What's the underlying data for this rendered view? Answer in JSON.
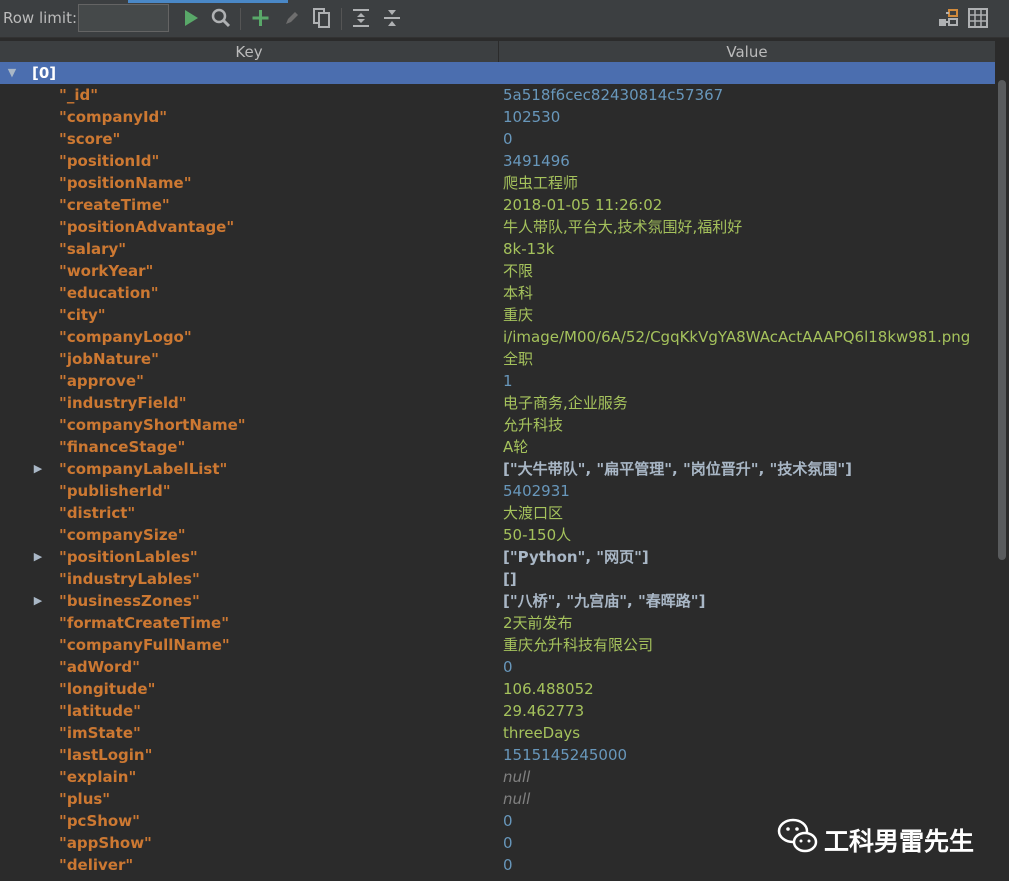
{
  "toolbar": {
    "row_limit_label": "Row limit:",
    "row_limit_value": ""
  },
  "header": {
    "key": "Key",
    "value": "Value"
  },
  "root": {
    "label": "[0]"
  },
  "rows": [
    {
      "key": "\"_id\"",
      "value": "5a518f6cec82430814c57367",
      "type": "num",
      "expandable": false
    },
    {
      "key": "\"companyId\"",
      "value": "102530",
      "type": "num",
      "expandable": false
    },
    {
      "key": "\"score\"",
      "value": "0",
      "type": "num",
      "expandable": false
    },
    {
      "key": "\"positionId\"",
      "value": "3491496",
      "type": "num",
      "expandable": false
    },
    {
      "key": "\"positionName\"",
      "value": "爬虫工程师",
      "type": "str",
      "expandable": false
    },
    {
      "key": "\"createTime\"",
      "value": "2018-01-05 11:26:02",
      "type": "str",
      "expandable": false
    },
    {
      "key": "\"positionAdvantage\"",
      "value": "牛人带队,平台大,技术氛围好,福利好",
      "type": "str",
      "expandable": false
    },
    {
      "key": "\"salary\"",
      "value": "8k-13k",
      "type": "str",
      "expandable": false
    },
    {
      "key": "\"workYear\"",
      "value": "不限",
      "type": "str",
      "expandable": false
    },
    {
      "key": "\"education\"",
      "value": "本科",
      "type": "str",
      "expandable": false
    },
    {
      "key": "\"city\"",
      "value": "重庆",
      "type": "str",
      "expandable": false
    },
    {
      "key": "\"companyLogo\"",
      "value": "i/image/M00/6A/52/CgqKkVgYA8WAcActAAAPQ6l18kw981.png",
      "type": "str",
      "expandable": false
    },
    {
      "key": "\"jobNature\"",
      "value": "全职",
      "type": "str",
      "expandable": false
    },
    {
      "key": "\"approve\"",
      "value": "1",
      "type": "num",
      "expandable": false
    },
    {
      "key": "\"industryField\"",
      "value": "电子商务,企业服务",
      "type": "str",
      "expandable": false
    },
    {
      "key": "\"companyShortName\"",
      "value": "允升科技",
      "type": "str",
      "expandable": false
    },
    {
      "key": "\"financeStage\"",
      "value": "A轮",
      "type": "str",
      "expandable": false
    },
    {
      "key": "\"companyLabelList\"",
      "value": "[\"大牛带队\", \"扁平管理\", \"岗位晋升\", \"技术氛围\"]",
      "type": "list",
      "expandable": true
    },
    {
      "key": "\"publisherId\"",
      "value": "5402931",
      "type": "num",
      "expandable": false
    },
    {
      "key": "\"district\"",
      "value": "大渡口区",
      "type": "str",
      "expandable": false
    },
    {
      "key": "\"companySize\"",
      "value": "50-150人",
      "type": "str",
      "expandable": false
    },
    {
      "key": "\"positionLables\"",
      "value": "[\"Python\", \"网页\"]",
      "type": "list",
      "expandable": true
    },
    {
      "key": "\"industryLables\"",
      "value": "[]",
      "type": "list",
      "expandable": false
    },
    {
      "key": "\"businessZones\"",
      "value": "[\"八桥\", \"九宫庙\", \"春晖路\"]",
      "type": "list",
      "expandable": true
    },
    {
      "key": "\"formatCreateTime\"",
      "value": "2天前发布",
      "type": "str",
      "expandable": false
    },
    {
      "key": "\"companyFullName\"",
      "value": "重庆允升科技有限公司",
      "type": "str",
      "expandable": false
    },
    {
      "key": "\"adWord\"",
      "value": "0",
      "type": "num",
      "expandable": false
    },
    {
      "key": "\"longitude\"",
      "value": "106.488052",
      "type": "str",
      "expandable": false
    },
    {
      "key": "\"latitude\"",
      "value": "29.462773",
      "type": "str",
      "expandable": false
    },
    {
      "key": "\"imState\"",
      "value": "threeDays",
      "type": "str",
      "expandable": false
    },
    {
      "key": "\"lastLogin\"",
      "value": "1515145245000",
      "type": "num",
      "expandable": false
    },
    {
      "key": "\"explain\"",
      "value": "null",
      "type": "null",
      "expandable": false
    },
    {
      "key": "\"plus\"",
      "value": "null",
      "type": "null",
      "expandable": false
    },
    {
      "key": "\"pcShow\"",
      "value": "0",
      "type": "num",
      "expandable": false
    },
    {
      "key": "\"appShow\"",
      "value": "0",
      "type": "num",
      "expandable": false
    },
    {
      "key": "\"deliver\"",
      "value": "0",
      "type": "num",
      "expandable": false
    }
  ],
  "watermark": {
    "text": "工科男雷先生"
  },
  "icons": {
    "run": "play-icon",
    "find": "search-icon",
    "add": "plus-icon",
    "edit": "pencil-icon",
    "copy": "copy-icon",
    "expand_all": "expand-all-icon",
    "collapse_all": "collapse-all-icon",
    "tree_view": "tree-view-icon",
    "table_view": "table-view-icon",
    "wechat": "wechat-icon"
  },
  "colors": {
    "key": "#cc7832",
    "string": "#a5c25c",
    "number": "#6897bb",
    "null": "#808080",
    "selection": "#4b6eaf",
    "background": "#2b2b2b"
  }
}
